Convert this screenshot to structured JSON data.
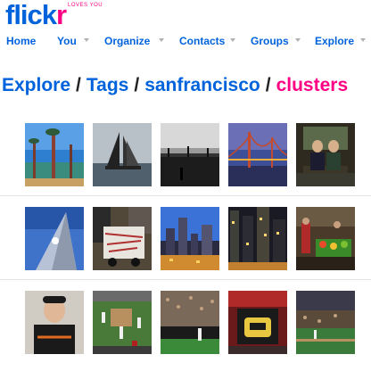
{
  "logo": {
    "name": "flickr",
    "text_main": "flick",
    "text_accent": "r",
    "tagline": "LOVES YOU"
  },
  "nav": {
    "items": [
      {
        "label": "Home",
        "has_menu": false
      },
      {
        "label": "You",
        "has_menu": true
      },
      {
        "label": "Organize",
        "has_menu": true
      },
      {
        "label": "Contacts",
        "has_menu": true
      },
      {
        "label": "Groups",
        "has_menu": true
      },
      {
        "label": "Explore",
        "has_menu": true
      }
    ]
  },
  "breadcrumb": {
    "items": [
      "Explore",
      "Tags",
      "sanfrancisco"
    ],
    "current": "clusters",
    "separator": "/"
  },
  "colors": {
    "link": "#0063dc",
    "accent": "#ff0084",
    "divider": "#e4e4e4"
  },
  "clusters": [
    {
      "photos": [
        {
          "name": "photo-palm-trees-bay"
        },
        {
          "name": "photo-sailboat"
        },
        {
          "name": "photo-pier-black-white"
        },
        {
          "name": "photo-bay-bridge-dusk"
        },
        {
          "name": "photo-two-people-on-bench"
        }
      ]
    },
    {
      "photos": [
        {
          "name": "photo-transamerica-pyramid"
        },
        {
          "name": "photo-graffiti-truck"
        },
        {
          "name": "photo-city-skyline-dusk"
        },
        {
          "name": "photo-city-night-lights"
        },
        {
          "name": "photo-produce-market"
        }
      ]
    },
    {
      "photos": [
        {
          "name": "photo-man-in-cap"
        },
        {
          "name": "photo-baseball-field-action"
        },
        {
          "name": "photo-ballpark-crowd"
        },
        {
          "name": "photo-road-to-history-sign"
        },
        {
          "name": "photo-ballpark-stands"
        }
      ]
    }
  ]
}
